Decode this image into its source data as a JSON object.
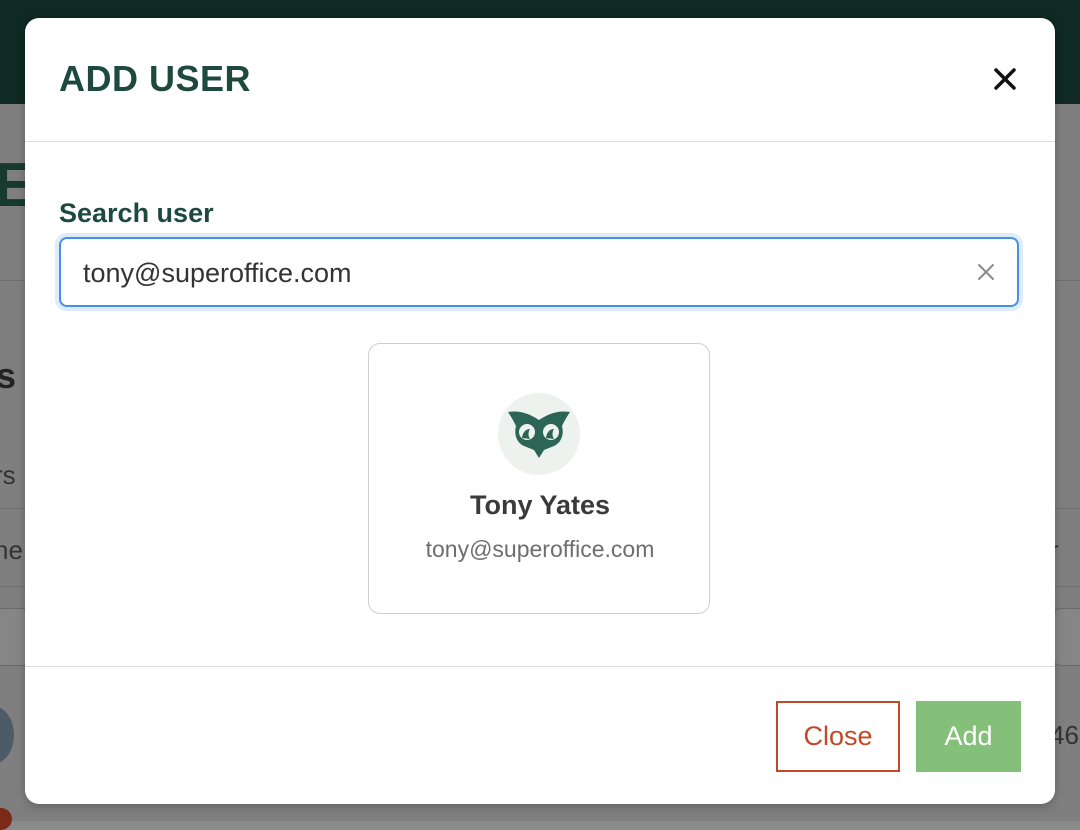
{
  "background": {
    "fragments": {
      "heading_letter": "E",
      "section_letter": "s",
      "sub_fragment": "rs",
      "column_left": "ne",
      "column_right": "r",
      "row_value": "46"
    }
  },
  "modal": {
    "title": "ADD USER",
    "close_icon": "close-icon",
    "search": {
      "label": "Search user",
      "value": "tony@superoffice.com",
      "clear_icon": "clear-icon"
    },
    "result": {
      "name": "Tony Yates",
      "email": "tony@superoffice.com",
      "avatar_icon": "owl-avatar-icon"
    },
    "footer": {
      "close_label": "Close",
      "add_label": "Add"
    }
  },
  "colors": {
    "brand": "#1d4a3d",
    "focus": "#4a90e2",
    "danger": "#c0492a",
    "success": "#84c079"
  }
}
